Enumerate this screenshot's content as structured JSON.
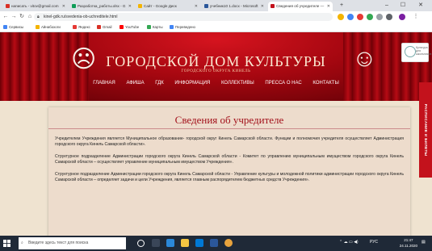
{
  "browser": {
    "tabs": [
      {
        "label": "написать - vitov@gmail.com",
        "color": "#d93025"
      },
      {
        "label": "Разработка_работы.xlsx - G",
        "color": "#0f9d58"
      },
      {
        "label": "Сайт - Google Диск",
        "color": "#f4b400"
      },
      {
        "label": "учебник10 1.docx - Microsoft",
        "color": "#2b579a"
      },
      {
        "label": "Сведения об учредителе —",
        "color": "#c3121c"
      }
    ],
    "url": "kinel-gdk.ru/svedenia-ob-uchreditele.html",
    "bookmarks": [
      {
        "label": "Сервисы",
        "color": "#4285f4"
      },
      {
        "label": "Айнабохоги",
        "color": "#f4b400"
      },
      {
        "label": "Яндекс",
        "color": "#e53935"
      },
      {
        "label": "Gmail",
        "color": "#d93025"
      },
      {
        "label": "YouTube",
        "color": "#ff0000"
      },
      {
        "label": "Карты",
        "color": "#34a853"
      },
      {
        "label": "Переведено",
        "color": "#4285f4"
      }
    ]
  },
  "site": {
    "title": "ГОРОДСКОЙ ДОМ КУЛЬТУРЫ",
    "subtitle": "ГОРОДСКОГО ОКРУГА КИНЕЛЬ",
    "menu": [
      "Главная",
      "Афиша",
      "ГДК",
      "Информация",
      "Коллективы",
      "Пресса о нас",
      "Контакты"
    ],
    "side_tab": "РАСПИСАНИЕ И БИЛЕТЫ",
    "badge_text": "Культура для школьников"
  },
  "content": {
    "heading": "Сведения об учредителе",
    "paragraphs": [
      "Учредителем Учреждения является Муниципальное образование- городской округ Кинель Самарской области. Функции и полномочия учредителя осуществляет Администрация городского округа Кинель Самарской области».",
      "Структурное подразделение Администрации городского округа Кинель Самарской области - Комитет по управлению муниципальным имуществом городского округа Кинель Самарской области – осуществляет управление муниципальным имуществом Учреждения».",
      "Структурное подразделение Администрации городского округа Кинель Самарской области - Управление культуры и молодежной политики администрации городского округа Кинель Самарской области – определяет задачи и цели Учреждения, является главным распорядителем бюджетных средств Учреждения»."
    ]
  },
  "taskbar": {
    "search_placeholder": "Введите здесь текст для поиска",
    "lang": "РУС",
    "time": "21:47",
    "date": "24.11.2020"
  }
}
